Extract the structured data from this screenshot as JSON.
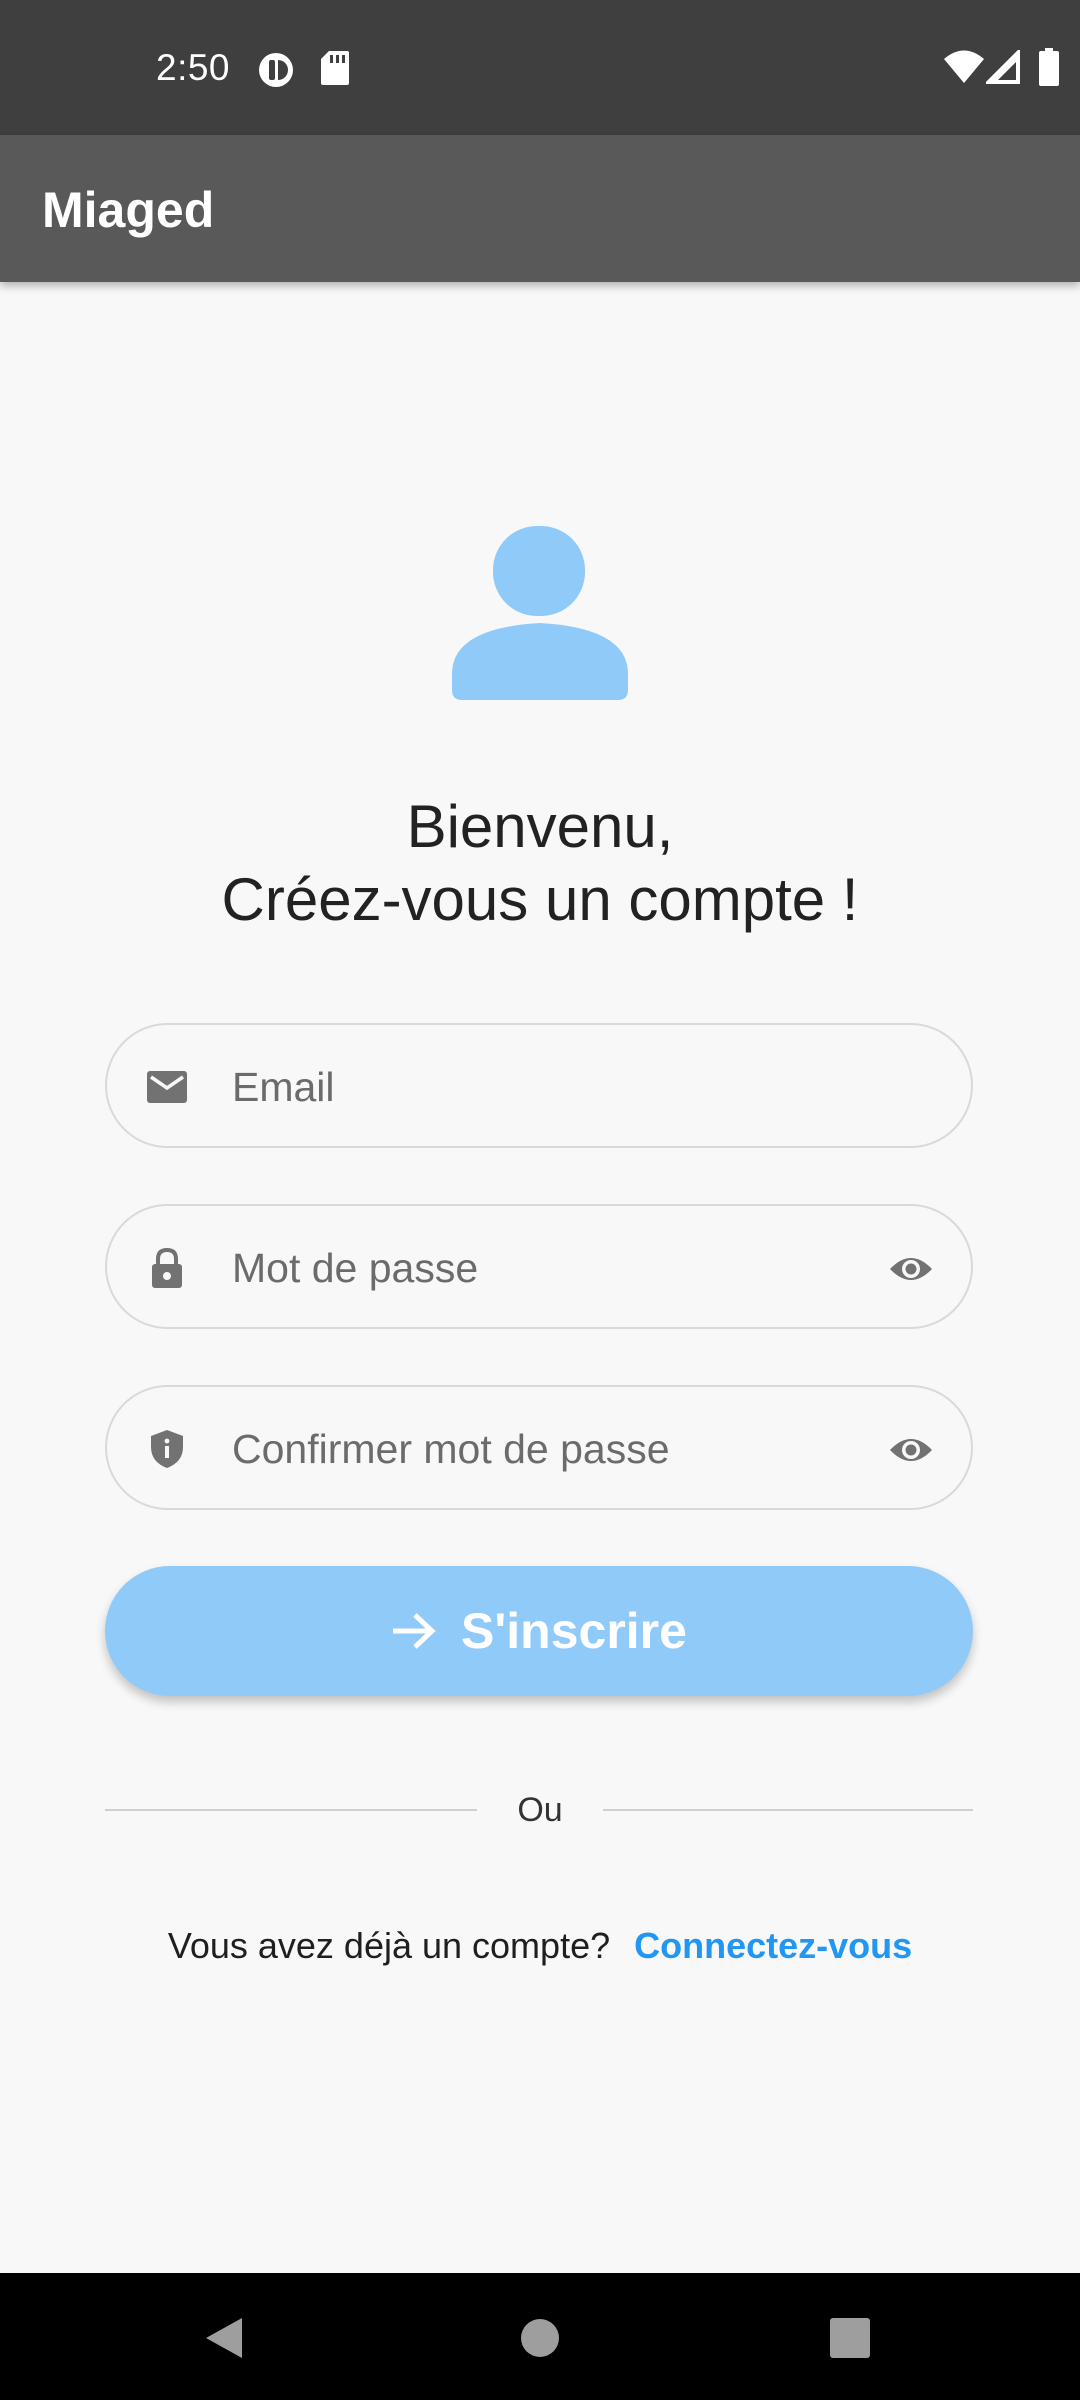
{
  "status_bar": {
    "time": "2:50",
    "icons": [
      "data-saver-icon",
      "sd-card-icon",
      "wifi-icon",
      "signal-icon",
      "battery-icon"
    ]
  },
  "app_bar": {
    "title": "Miaged"
  },
  "avatar": {
    "icon": "person-icon",
    "color": "#90caf9"
  },
  "heading": {
    "line1": "Bienvenu,",
    "line2": "Créez-vous un compte !"
  },
  "form": {
    "email": {
      "placeholder": "Email",
      "icon": "email-icon"
    },
    "password": {
      "placeholder": "Mot de passe",
      "icon": "lock-icon",
      "toggle_icon": "eye-icon"
    },
    "confirm_password": {
      "placeholder": "Confirmer mot de passe",
      "icon": "shield-icon",
      "toggle_icon": "eye-icon"
    },
    "submit": {
      "label": "S'inscrire",
      "icon": "arrow-right-icon",
      "color": "#90caf9"
    }
  },
  "divider": {
    "label": "Ou"
  },
  "signin": {
    "prompt": "Vous avez déjà un compte?",
    "link": "Connectez-vous",
    "link_color": "#2196f3"
  },
  "nav_bar": {
    "buttons": [
      "back-icon",
      "home-icon",
      "recents-icon"
    ]
  }
}
